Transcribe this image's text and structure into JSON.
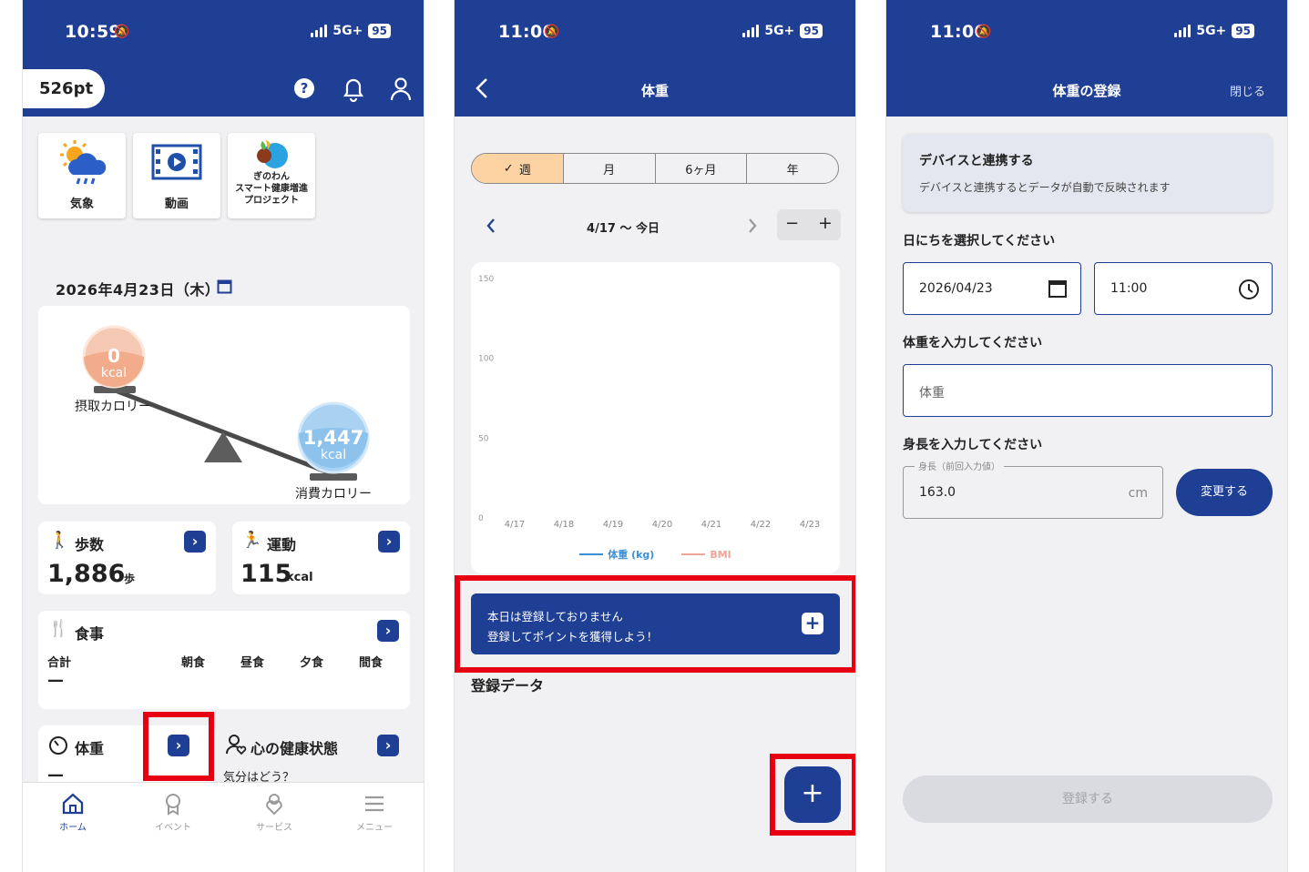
{
  "screen1": {
    "status": {
      "time": "10:59",
      "network": "5G+",
      "battery": "95"
    },
    "points": "526pt",
    "tiles": [
      {
        "label": "気象",
        "icon": "weather-icon"
      },
      {
        "label": "動画",
        "icon": "video-icon"
      },
      {
        "label": "ぎのわん\nスマート健康増進\nプロジェクト",
        "icon": "ginowan-logo"
      }
    ],
    "date": "2026年4月23日（木）",
    "balance": {
      "intake_value": "0",
      "intake_unit": "kcal",
      "intake_label": "摂取カロリー",
      "burn_value": "1,447",
      "burn_unit": "kcal",
      "burn_label": "消費カロリー"
    },
    "steps": {
      "title": "歩数",
      "value": "1,886",
      "unit": "歩"
    },
    "exercise": {
      "title": "運動",
      "value": "115",
      "unit": "kcal"
    },
    "meals": {
      "title": "食事",
      "total_label": "合計",
      "total_value": "—",
      "cols": [
        "朝食",
        "昼食",
        "夕食",
        "間食"
      ]
    },
    "weight": {
      "title": "体重",
      "value": "—"
    },
    "mental": {
      "title": "心の健康状態",
      "sub": "気分はどう？"
    },
    "tabs": [
      {
        "label": "ホーム",
        "active": true
      },
      {
        "label": "イベント"
      },
      {
        "label": "サービス"
      },
      {
        "label": "メニュー"
      }
    ]
  },
  "screen2": {
    "status": {
      "time": "11:00",
      "network": "5G+",
      "battery": "95"
    },
    "title": "体重",
    "periods": [
      "週",
      "月",
      "6ヶ月",
      "年"
    ],
    "range": "4/17 〜 今日",
    "minus": "−",
    "plus": "+",
    "chart_data": {
      "type": "line",
      "x": [
        "4/17",
        "4/18",
        "4/19",
        "4/20",
        "4/21",
        "4/22",
        "4/23"
      ],
      "yticks": [
        150,
        100,
        50,
        0
      ],
      "ylim": [
        0,
        150
      ],
      "series": [
        {
          "name": "体重 (kg)",
          "color": "#3a8fd9",
          "values": []
        },
        {
          "name": "BMI",
          "color": "#f0a59a",
          "values": []
        }
      ]
    },
    "banner": {
      "line1": "本日は登録しておりません",
      "line2": "登録してポイントを獲得しよう！"
    },
    "section": "登録データ",
    "fab": "+"
  },
  "screen3": {
    "status": {
      "time": "11:00",
      "network": "5G+",
      "battery": "95"
    },
    "title": "体重の登録",
    "close": "閉じる",
    "device": {
      "title": "デバイスと連携する",
      "desc": "デバイスと連携するとデータが自動で反映されます"
    },
    "date_label": "日にちを選択してください",
    "date_value": "2026/04/23",
    "time_value": "11:00",
    "weight_label": "体重を入力してください",
    "weight_placeholder": "体重",
    "height_label": "身長を入力してください",
    "height_float": "身長（前回入力値）",
    "height_value": "163.0",
    "height_unit": "cm",
    "change": "変更する",
    "submit": "登録する"
  }
}
